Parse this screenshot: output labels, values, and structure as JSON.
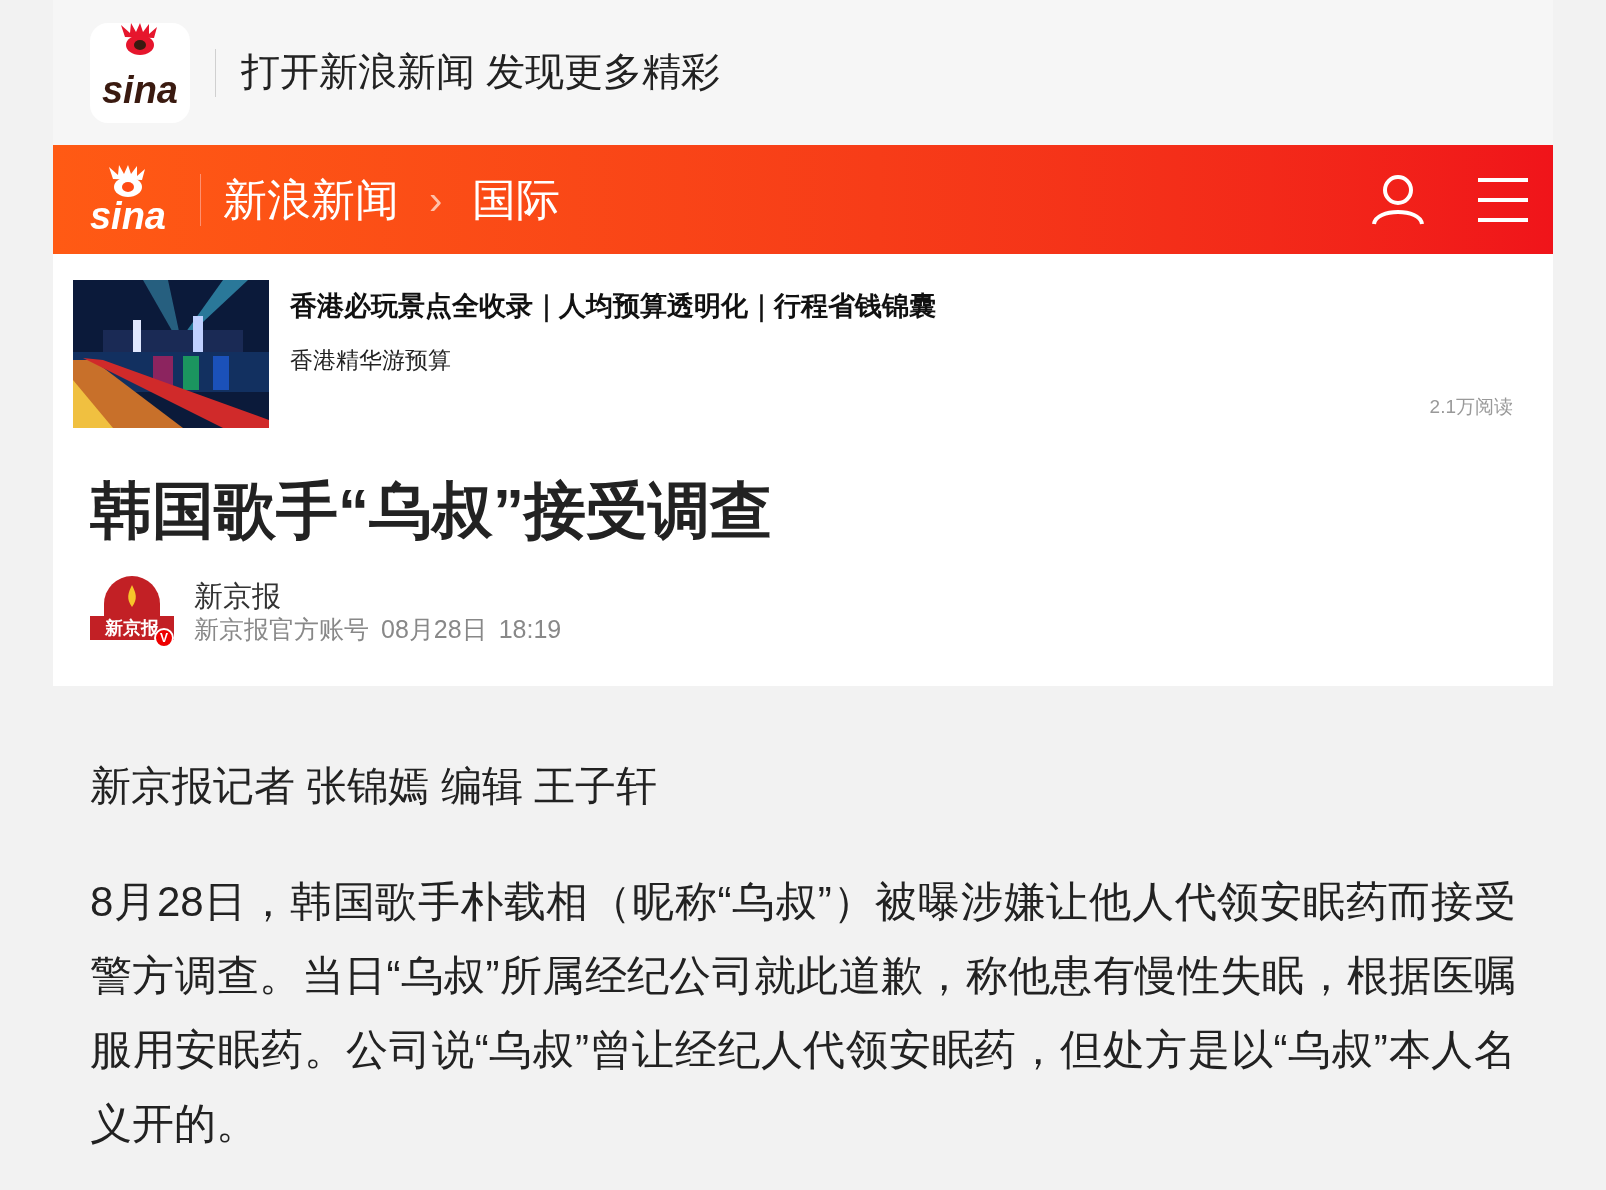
{
  "app_banner": {
    "logo_text": "sina",
    "slogan": "打开新浪新闻 发现更多精彩"
  },
  "header": {
    "logo_text": "sina",
    "breadcrumbs": [
      "新浪新闻",
      "国际"
    ],
    "separator": "›"
  },
  "ad": {
    "title": "香港必玩景点全收录｜人均预算透明化｜行程省钱锦囊",
    "subtitle": "香港精华游预算",
    "reads": "2.1万阅读"
  },
  "article": {
    "title": "韩国歌手“乌叔”接受调查",
    "author": {
      "avatar_text": "新京报",
      "verified_mark": "V",
      "name": "新京报",
      "account": "新京报官方账号",
      "date": "08月28日",
      "time": "18:19"
    },
    "byline": "新京报记者 张锦嫣 编辑 王子轩",
    "paragraphs": [
      "8月28日，韩国歌手朴载相（昵称“乌叔”）被曝涉嫌让他人代领安眠药而接受警方调查。当日“乌叔”所属经纪公司就此道歉，称他患有慢性失眠，根据医嘱服用安眠药。公司说“乌叔”曾让经纪人代领安眠药，但处方是以“乌叔”本人名义开的。"
    ]
  }
}
